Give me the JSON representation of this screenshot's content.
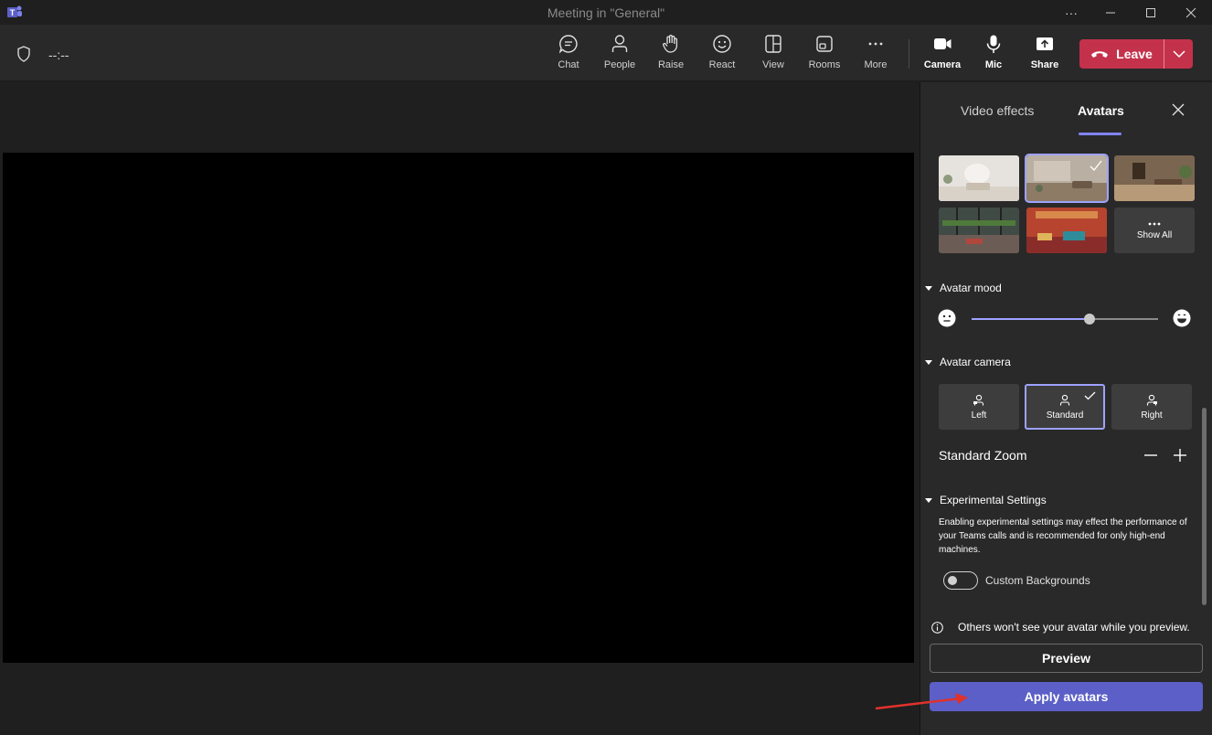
{
  "window": {
    "title": "Meeting in \"General\""
  },
  "toolbar": {
    "timer": "--:--",
    "buttons": {
      "chat": "Chat",
      "people": "People",
      "raise": "Raise",
      "react": "React",
      "view": "View",
      "rooms": "Rooms",
      "more": "More",
      "camera": "Camera",
      "mic": "Mic",
      "share": "Share"
    },
    "leave_label": "Leave"
  },
  "panel": {
    "tabs": {
      "video_effects": "Video effects",
      "avatars": "Avatars"
    },
    "environments": {
      "show_all": "Show All",
      "selected_index": 1
    },
    "avatar_mood": {
      "heading": "Avatar mood",
      "level_fraction": 0.63
    },
    "avatar_camera": {
      "heading": "Avatar camera",
      "options": [
        "Left",
        "Standard",
        "Right"
      ],
      "selected": "Standard"
    },
    "zoom_label": "Standard Zoom",
    "experimental": {
      "heading": "Experimental Settings",
      "description": "Enabling experimental settings may effect the performance of your Teams calls and is recommended for only high-end machines.",
      "custom_backgrounds_label": "Custom Backgrounds",
      "custom_backgrounds_on": false
    },
    "info_text": "Others won't see your avatar while you preview.",
    "preview_label": "Preview",
    "apply_label": "Apply avatars"
  },
  "colors": {
    "accent": "#5b5fc7",
    "leave": "#c4314b",
    "selection": "#9ea2ff"
  }
}
